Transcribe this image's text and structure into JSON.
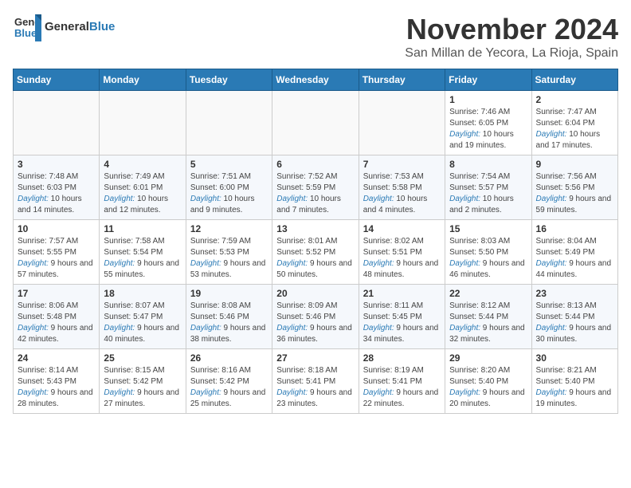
{
  "header": {
    "logo_general": "General",
    "logo_blue": "Blue",
    "month_title": "November 2024",
    "location": "San Millan de Yecora, La Rioja, Spain"
  },
  "weekdays": [
    "Sunday",
    "Monday",
    "Tuesday",
    "Wednesday",
    "Thursday",
    "Friday",
    "Saturday"
  ],
  "weeks": [
    [
      {
        "day": "",
        "info": ""
      },
      {
        "day": "",
        "info": ""
      },
      {
        "day": "",
        "info": ""
      },
      {
        "day": "",
        "info": ""
      },
      {
        "day": "",
        "info": ""
      },
      {
        "day": "1",
        "sunrise": "Sunrise: 7:46 AM",
        "sunset": "Sunset: 6:05 PM",
        "daylight": "Daylight: 10 hours and 19 minutes."
      },
      {
        "day": "2",
        "sunrise": "Sunrise: 7:47 AM",
        "sunset": "Sunset: 6:04 PM",
        "daylight": "Daylight: 10 hours and 17 minutes."
      }
    ],
    [
      {
        "day": "3",
        "sunrise": "Sunrise: 7:48 AM",
        "sunset": "Sunset: 6:03 PM",
        "daylight": "Daylight: 10 hours and 14 minutes."
      },
      {
        "day": "4",
        "sunrise": "Sunrise: 7:49 AM",
        "sunset": "Sunset: 6:01 PM",
        "daylight": "Daylight: 10 hours and 12 minutes."
      },
      {
        "day": "5",
        "sunrise": "Sunrise: 7:51 AM",
        "sunset": "Sunset: 6:00 PM",
        "daylight": "Daylight: 10 hours and 9 minutes."
      },
      {
        "day": "6",
        "sunrise": "Sunrise: 7:52 AM",
        "sunset": "Sunset: 5:59 PM",
        "daylight": "Daylight: 10 hours and 7 minutes."
      },
      {
        "day": "7",
        "sunrise": "Sunrise: 7:53 AM",
        "sunset": "Sunset: 5:58 PM",
        "daylight": "Daylight: 10 hours and 4 minutes."
      },
      {
        "day": "8",
        "sunrise": "Sunrise: 7:54 AM",
        "sunset": "Sunset: 5:57 PM",
        "daylight": "Daylight: 10 hours and 2 minutes."
      },
      {
        "day": "9",
        "sunrise": "Sunrise: 7:56 AM",
        "sunset": "Sunset: 5:56 PM",
        "daylight": "Daylight: 9 hours and 59 minutes."
      }
    ],
    [
      {
        "day": "10",
        "sunrise": "Sunrise: 7:57 AM",
        "sunset": "Sunset: 5:55 PM",
        "daylight": "Daylight: 9 hours and 57 minutes."
      },
      {
        "day": "11",
        "sunrise": "Sunrise: 7:58 AM",
        "sunset": "Sunset: 5:54 PM",
        "daylight": "Daylight: 9 hours and 55 minutes."
      },
      {
        "day": "12",
        "sunrise": "Sunrise: 7:59 AM",
        "sunset": "Sunset: 5:53 PM",
        "daylight": "Daylight: 9 hours and 53 minutes."
      },
      {
        "day": "13",
        "sunrise": "Sunrise: 8:01 AM",
        "sunset": "Sunset: 5:52 PM",
        "daylight": "Daylight: 9 hours and 50 minutes."
      },
      {
        "day": "14",
        "sunrise": "Sunrise: 8:02 AM",
        "sunset": "Sunset: 5:51 PM",
        "daylight": "Daylight: 9 hours and 48 minutes."
      },
      {
        "day": "15",
        "sunrise": "Sunrise: 8:03 AM",
        "sunset": "Sunset: 5:50 PM",
        "daylight": "Daylight: 9 hours and 46 minutes."
      },
      {
        "day": "16",
        "sunrise": "Sunrise: 8:04 AM",
        "sunset": "Sunset: 5:49 PM",
        "daylight": "Daylight: 9 hours and 44 minutes."
      }
    ],
    [
      {
        "day": "17",
        "sunrise": "Sunrise: 8:06 AM",
        "sunset": "Sunset: 5:48 PM",
        "daylight": "Daylight: 9 hours and 42 minutes."
      },
      {
        "day": "18",
        "sunrise": "Sunrise: 8:07 AM",
        "sunset": "Sunset: 5:47 PM",
        "daylight": "Daylight: 9 hours and 40 minutes."
      },
      {
        "day": "19",
        "sunrise": "Sunrise: 8:08 AM",
        "sunset": "Sunset: 5:46 PM",
        "daylight": "Daylight: 9 hours and 38 minutes."
      },
      {
        "day": "20",
        "sunrise": "Sunrise: 8:09 AM",
        "sunset": "Sunset: 5:46 PM",
        "daylight": "Daylight: 9 hours and 36 minutes."
      },
      {
        "day": "21",
        "sunrise": "Sunrise: 8:11 AM",
        "sunset": "Sunset: 5:45 PM",
        "daylight": "Daylight: 9 hours and 34 minutes."
      },
      {
        "day": "22",
        "sunrise": "Sunrise: 8:12 AM",
        "sunset": "Sunset: 5:44 PM",
        "daylight": "Daylight: 9 hours and 32 minutes."
      },
      {
        "day": "23",
        "sunrise": "Sunrise: 8:13 AM",
        "sunset": "Sunset: 5:44 PM",
        "daylight": "Daylight: 9 hours and 30 minutes."
      }
    ],
    [
      {
        "day": "24",
        "sunrise": "Sunrise: 8:14 AM",
        "sunset": "Sunset: 5:43 PM",
        "daylight": "Daylight: 9 hours and 28 minutes."
      },
      {
        "day": "25",
        "sunrise": "Sunrise: 8:15 AM",
        "sunset": "Sunset: 5:42 PM",
        "daylight": "Daylight: 9 hours and 27 minutes."
      },
      {
        "day": "26",
        "sunrise": "Sunrise: 8:16 AM",
        "sunset": "Sunset: 5:42 PM",
        "daylight": "Daylight: 9 hours and 25 minutes."
      },
      {
        "day": "27",
        "sunrise": "Sunrise: 8:18 AM",
        "sunset": "Sunset: 5:41 PM",
        "daylight": "Daylight: 9 hours and 23 minutes."
      },
      {
        "day": "28",
        "sunrise": "Sunrise: 8:19 AM",
        "sunset": "Sunset: 5:41 PM",
        "daylight": "Daylight: 9 hours and 22 minutes."
      },
      {
        "day": "29",
        "sunrise": "Sunrise: 8:20 AM",
        "sunset": "Sunset: 5:40 PM",
        "daylight": "Daylight: 9 hours and 20 minutes."
      },
      {
        "day": "30",
        "sunrise": "Sunrise: 8:21 AM",
        "sunset": "Sunset: 5:40 PM",
        "daylight": "Daylight: 9 hours and 19 minutes."
      }
    ]
  ]
}
